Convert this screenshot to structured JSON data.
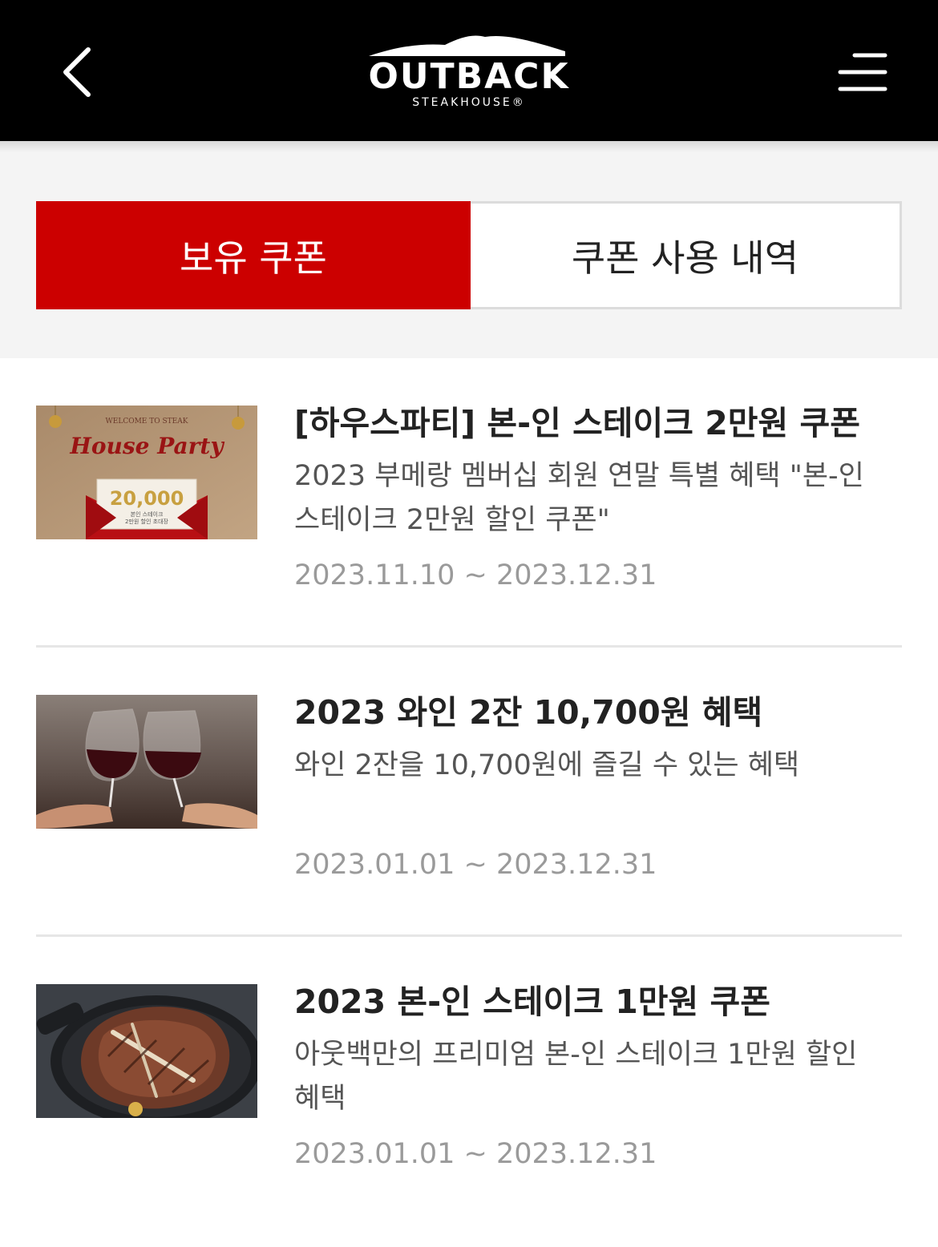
{
  "header": {
    "logo_main": "OUTBACK",
    "logo_sub": "STEAKHOUSE®"
  },
  "tabs": {
    "active_label": "보유 쿠폰",
    "inactive_label": "쿠폰 사용 내역"
  },
  "colors": {
    "brand_red": "#cc0000",
    "header_bg": "#000000",
    "tab_area_bg": "#f4f4f4"
  },
  "coupons": [
    {
      "title": "[하우스파티] 본-인 스테이크 2만원 쿠폰",
      "description": "2023 부메랑 멤버십 회원 연말 특별 혜택 \"본-인 스테이크 2만원 할인 쿠폰\"",
      "period": "2023.11.10 ~ 2023.12.31",
      "image": {
        "line1": "WELCOME TO STEAK",
        "line2": "House Party",
        "amount": "20,000",
        "caption1": "본인 스테이크",
        "caption2": "2만원 할인 초대장"
      }
    },
    {
      "title": "2023 와인 2잔 10,700원 혜택",
      "description": "와인 2잔을 10,700원에 즐길 수 있는 혜택",
      "period": "2023.01.01 ~ 2023.12.31"
    },
    {
      "title": "2023 본-인 스테이크 1만원 쿠폰",
      "description": "아웃백만의 프리미엄 본-인 스테이크 1만원 할인 혜택",
      "period": "2023.01.01 ~ 2023.12.31"
    }
  ]
}
